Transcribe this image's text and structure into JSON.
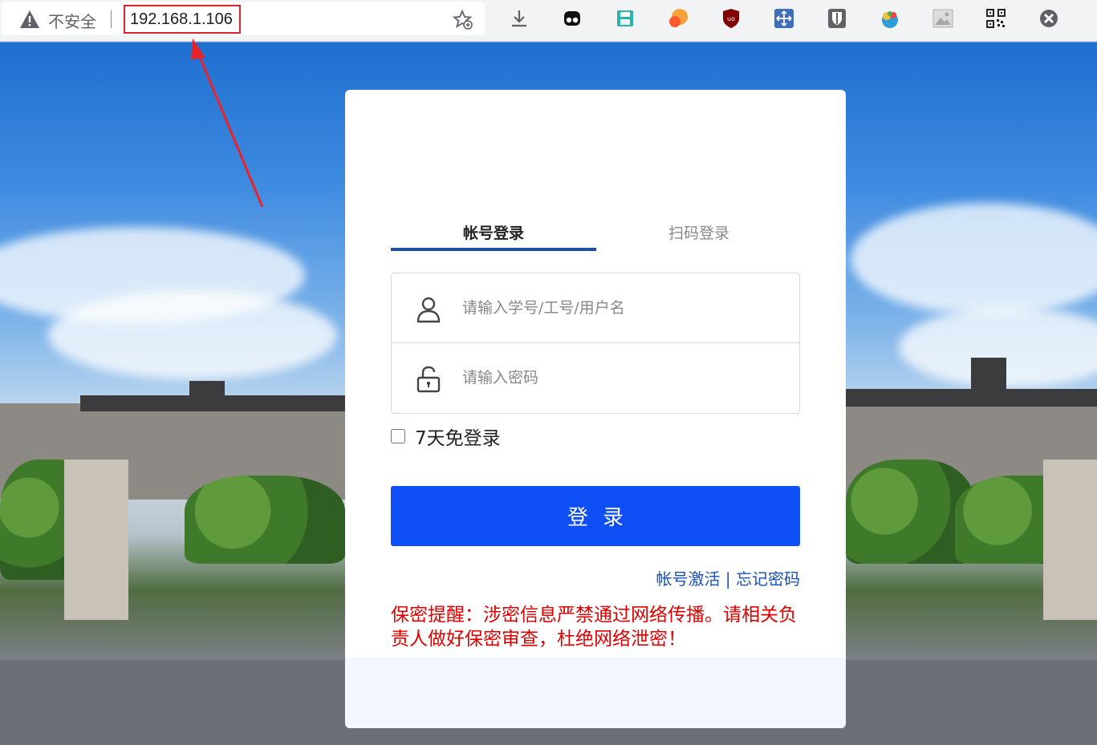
{
  "browser": {
    "insecure_label": "不安全",
    "url": "192.168.1.106",
    "extensions": [
      "download-icon",
      "ghost-icon",
      "save-icon",
      "gradient-icon",
      "ublock-icon",
      "move-icon",
      "bitwarden-icon",
      "fruit-icon",
      "image-icon",
      "qrcode-icon",
      "x-icon"
    ]
  },
  "login": {
    "tabs": [
      {
        "label": "帐号登录",
        "active": true
      },
      {
        "label": "扫码登录",
        "active": false
      }
    ],
    "username_placeholder": "请输入学号/工号/用户名",
    "password_placeholder": "请输入密码",
    "remember_label": "7天免登录",
    "submit_label": "登录",
    "activate_link": "帐号激活",
    "link_separator": "|",
    "forgot_link": "忘记密码",
    "notice": "保密提醒：涉密信息严禁通过网络传播。请相关负责人做好保密审查，杜绝网络泄密！"
  },
  "colors": {
    "accent": "#0d4ff5",
    "tab_underline": "#1e4fa8",
    "link": "#1a4fb6",
    "notice": "#e00000",
    "annotation": "#d8232a"
  }
}
